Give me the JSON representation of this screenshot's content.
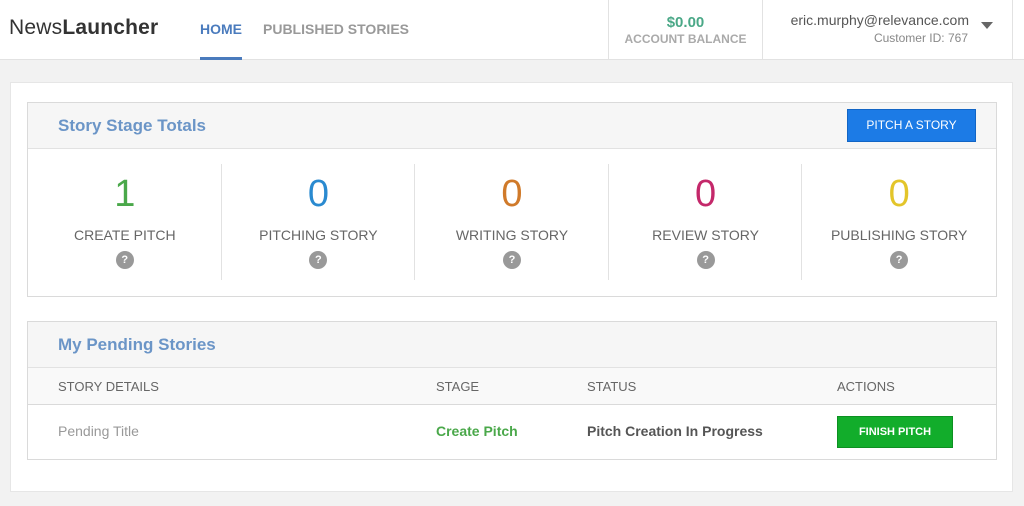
{
  "header": {
    "logo_part1": "News",
    "logo_part2": "Launcher",
    "nav": [
      {
        "label": "HOME",
        "active": true
      },
      {
        "label": "PUBLISHED STORIES",
        "active": false
      }
    ],
    "balance_amount": "$0.00",
    "balance_label": "ACCOUNT BALANCE",
    "user_email": "eric.murphy@relevance.com",
    "customer_id": "Customer ID: 767"
  },
  "stage_totals": {
    "title": "Story Stage Totals",
    "pitch_button": "PITCH A STORY",
    "help_glyph": "?",
    "stages": [
      {
        "count": "1",
        "label": "CREATE PITCH",
        "color": "#4aa84a"
      },
      {
        "count": "0",
        "label": "PITCHING STORY",
        "color": "#2a8ad0"
      },
      {
        "count": "0",
        "label": "WRITING STORY",
        "color": "#d07a2a"
      },
      {
        "count": "0",
        "label": "REVIEW STORY",
        "color": "#c4286a"
      },
      {
        "count": "0",
        "label": "PUBLISHING STORY",
        "color": "#e3c52a"
      }
    ]
  },
  "pending": {
    "title": "My Pending Stories",
    "columns": [
      "STORY DETAILS",
      "STAGE",
      "STATUS",
      "ACTIONS"
    ],
    "rows": [
      {
        "details": "Pending Title",
        "stage": "Create Pitch",
        "status": "Pitch Creation In Progress",
        "action": "FINISH PITCH"
      }
    ]
  }
}
